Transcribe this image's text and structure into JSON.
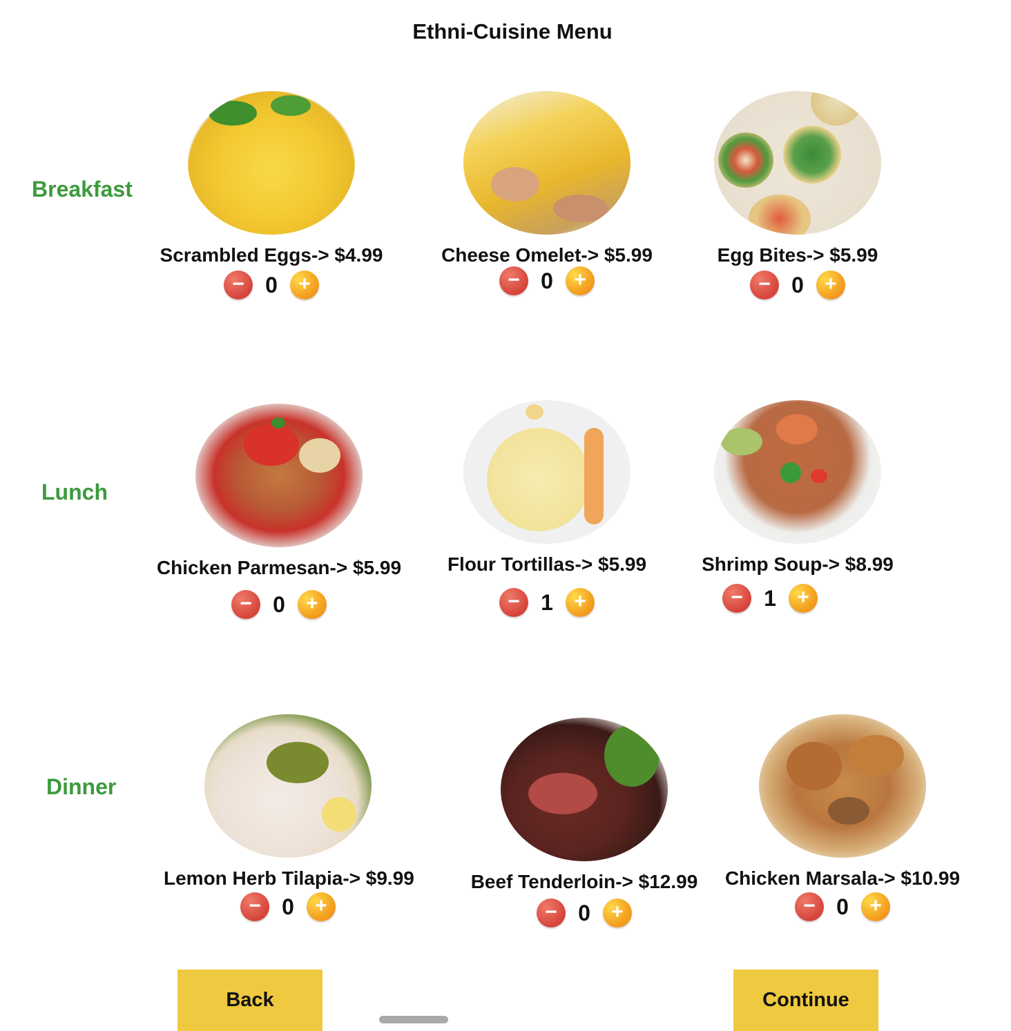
{
  "header": {
    "title": "Ethni-Cuisine Menu"
  },
  "categories": {
    "breakfast": "Breakfast",
    "lunch": "Lunch",
    "dinner": "Dinner"
  },
  "items": {
    "scrambled_eggs": {
      "label": "Scrambled Eggs-> $4.99",
      "qty": "0"
    },
    "cheese_omelet": {
      "label": "Cheese Omelet-> $5.99",
      "qty": "0"
    },
    "egg_bites": {
      "label": "Egg Bites-> $5.99",
      "qty": "0"
    },
    "chicken_parmesan": {
      "label": "Chicken Parmesan-> $5.99",
      "qty": "0"
    },
    "flour_tortillas": {
      "label": "Flour Tortillas-> $5.99",
      "qty": "1"
    },
    "shrimp_soup": {
      "label": "Shrimp Soup-> $8.99",
      "qty": "1"
    },
    "lemon_herb_tilapia": {
      "label": "Lemon Herb Tilapia-> $9.99",
      "qty": "0"
    },
    "beef_tenderloin": {
      "label": "Beef Tenderloin-> $12.99",
      "qty": "0"
    },
    "chicken_marsala": {
      "label": "Chicken Marsala-> $10.99",
      "qty": "0"
    }
  },
  "stepper": {
    "minus_glyph": "−",
    "plus_glyph": "+"
  },
  "footer": {
    "back_label": "Back",
    "continue_label": "Continue"
  },
  "colors": {
    "category_green": "#3d9a3e",
    "nav_button_yellow": "#efc93f",
    "minus_red": "#d5443b",
    "plus_orange": "#f5a623"
  }
}
